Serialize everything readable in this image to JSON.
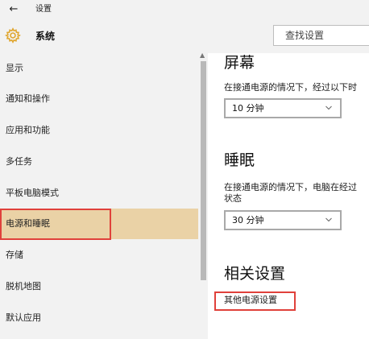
{
  "window": {
    "back_icon": "back-arrow-icon",
    "title": "设置"
  },
  "header": {
    "icon": "gear-icon",
    "title": "系统",
    "search_placeholder": "查找设置"
  },
  "sidebar": {
    "items": [
      {
        "label": "显示"
      },
      {
        "label": "通知和操作"
      },
      {
        "label": "应用和功能"
      },
      {
        "label": "多任务"
      },
      {
        "label": "平板电脑模式"
      },
      {
        "label": "电源和睡眠",
        "selected": true
      },
      {
        "label": "存储"
      },
      {
        "label": "脱机地图"
      },
      {
        "label": "默认应用"
      }
    ]
  },
  "main": {
    "screen": {
      "title": "屏幕",
      "desc": "在接通电源的情况下，经过以下时",
      "select_value": "10 分钟"
    },
    "sleep": {
      "title": "睡眠",
      "desc_line1": "在接通电源的情况下，电脑在经过",
      "desc_line2": "状态",
      "select_value": "30 分钟"
    },
    "related": {
      "title": "相关设置",
      "link": "其他电源设置"
    }
  },
  "colors": {
    "selected_bg": "#ead2a6",
    "highlight_border": "#e0413b",
    "gear": "#e0a62f"
  }
}
